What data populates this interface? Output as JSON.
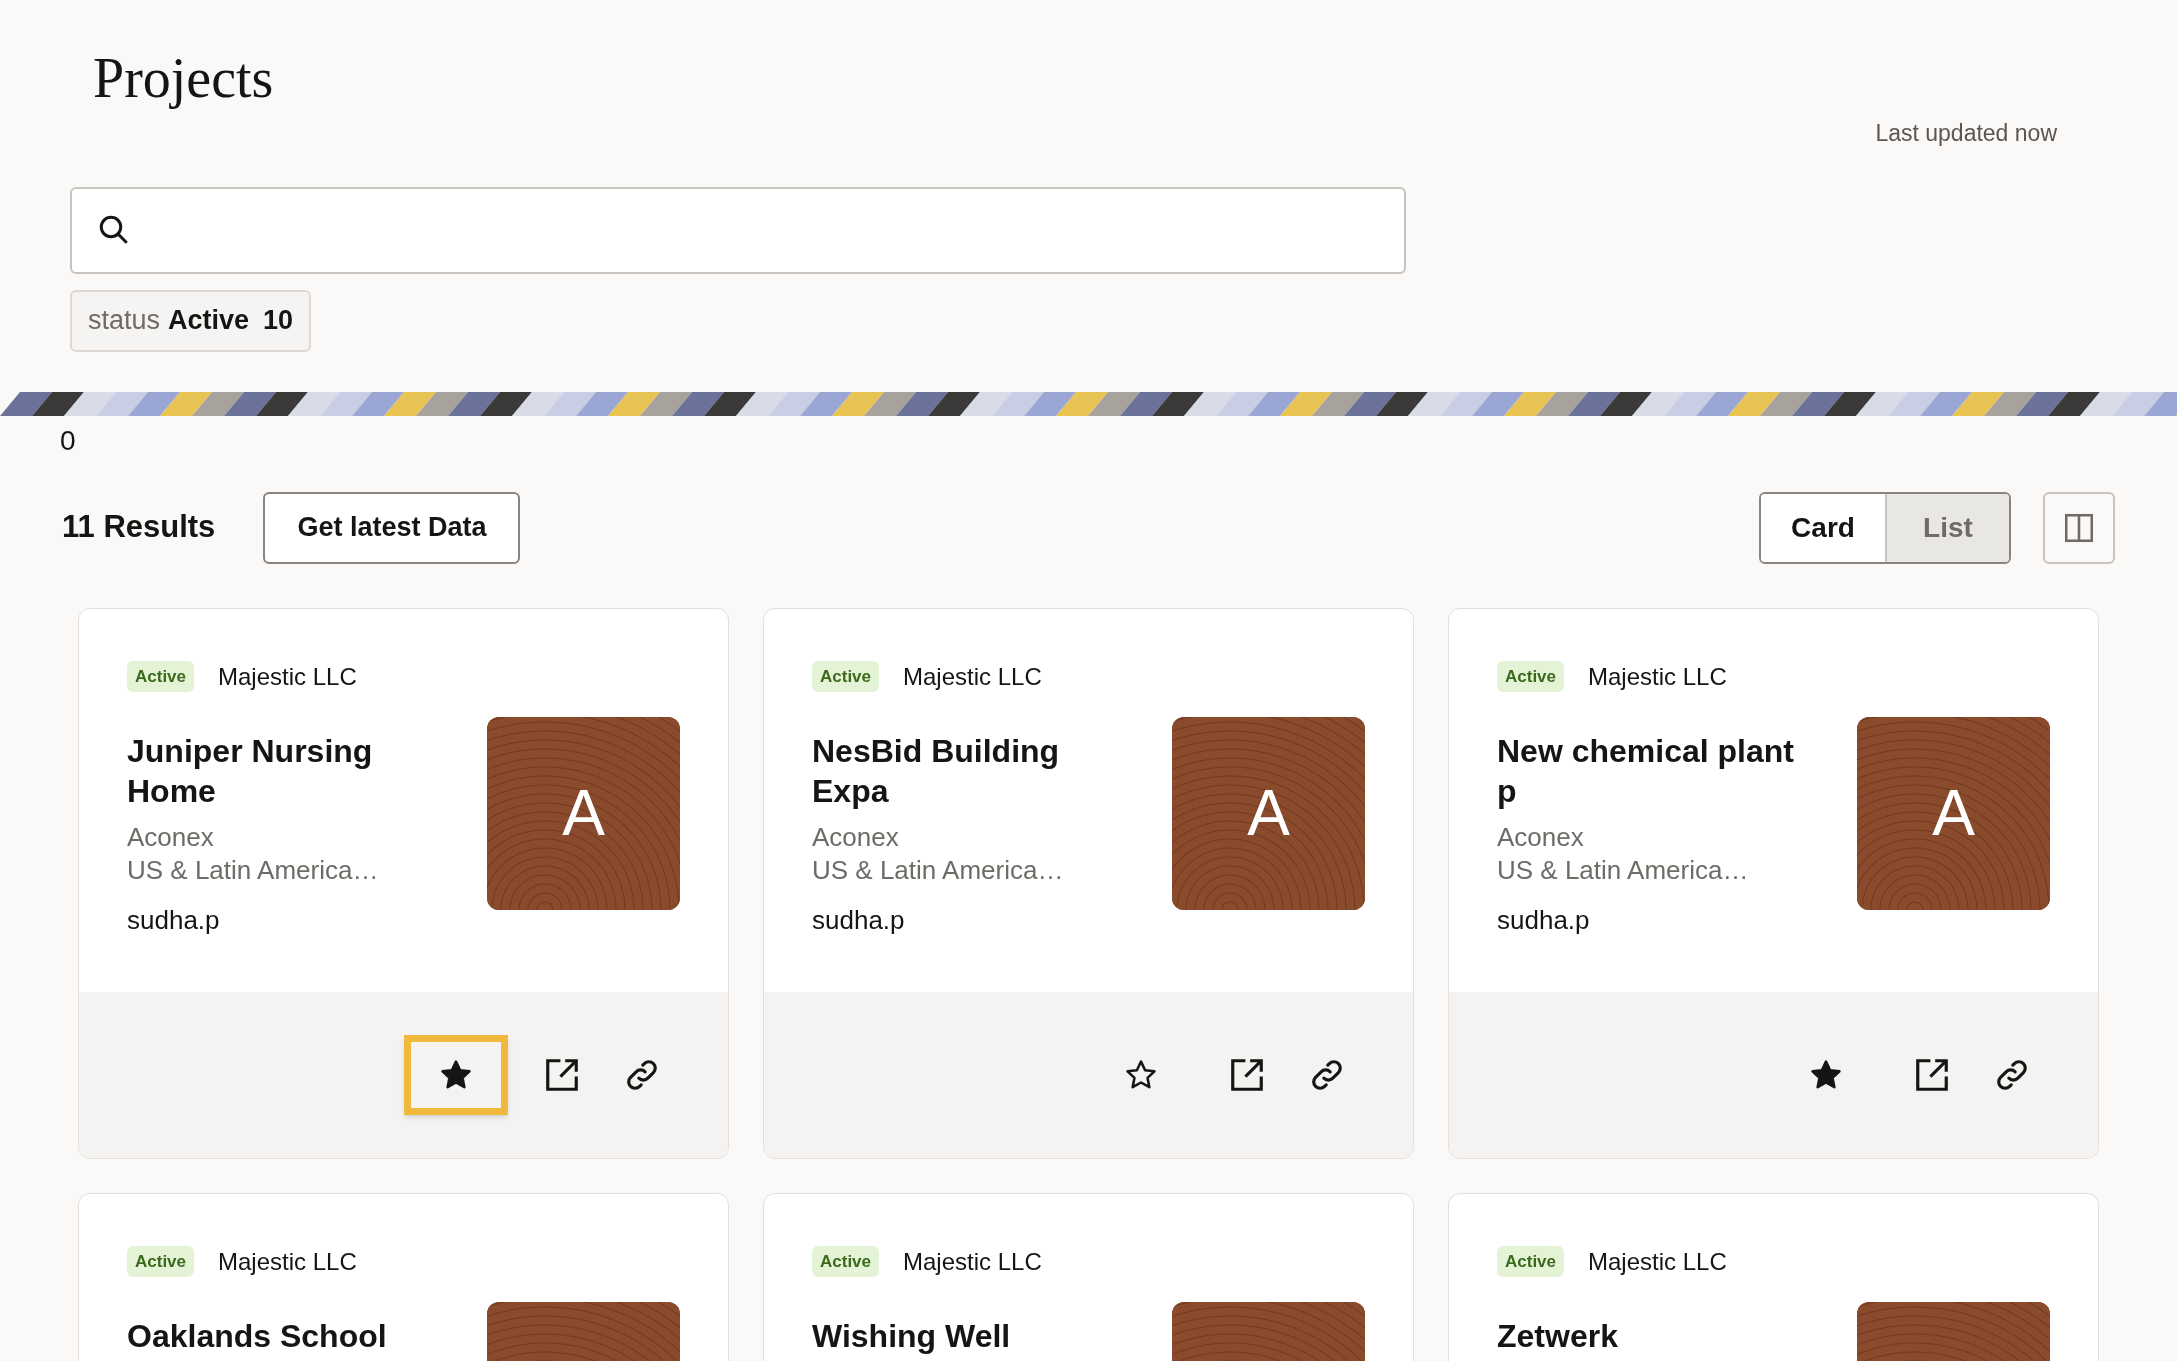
{
  "page": {
    "title": "Projects",
    "last_updated": "Last updated now"
  },
  "filter_chip": {
    "label": "status",
    "value": "Active",
    "count": "10"
  },
  "banner_counter": "0",
  "results": {
    "count": "11 Results",
    "refresh_button": "Get latest Data"
  },
  "view_toggle": [
    {
      "label": "Card",
      "selected": true
    },
    {
      "label": "List",
      "selected": false
    }
  ],
  "cards": [
    {
      "status": "Active",
      "company": "Majestic LLC",
      "title": "Juniper Nursing Home",
      "org": "Aconex",
      "region": "US & Latin America…",
      "owner": "sudha.p",
      "thumb_letter": "A",
      "starred": true,
      "focused": true
    },
    {
      "status": "Active",
      "company": "Majestic LLC",
      "title": "NesBid Building Expa",
      "org": "Aconex",
      "region": "US & Latin America…",
      "owner": "sudha.p",
      "thumb_letter": "A",
      "starred": false,
      "focused": false
    },
    {
      "status": "Active",
      "company": "Majestic LLC",
      "title": "New chemical plant p",
      "org": "Aconex",
      "region": "US & Latin America…",
      "owner": "sudha.p",
      "thumb_letter": "A",
      "starred": true,
      "focused": false
    },
    {
      "status": "Active",
      "company": "Majestic LLC",
      "title": "Oaklands School"
    },
    {
      "status": "Active",
      "company": "Majestic LLC",
      "title": "Wishing Well"
    },
    {
      "status": "Active",
      "company": "Majestic LLC",
      "title": "Zetwerk"
    }
  ]
}
